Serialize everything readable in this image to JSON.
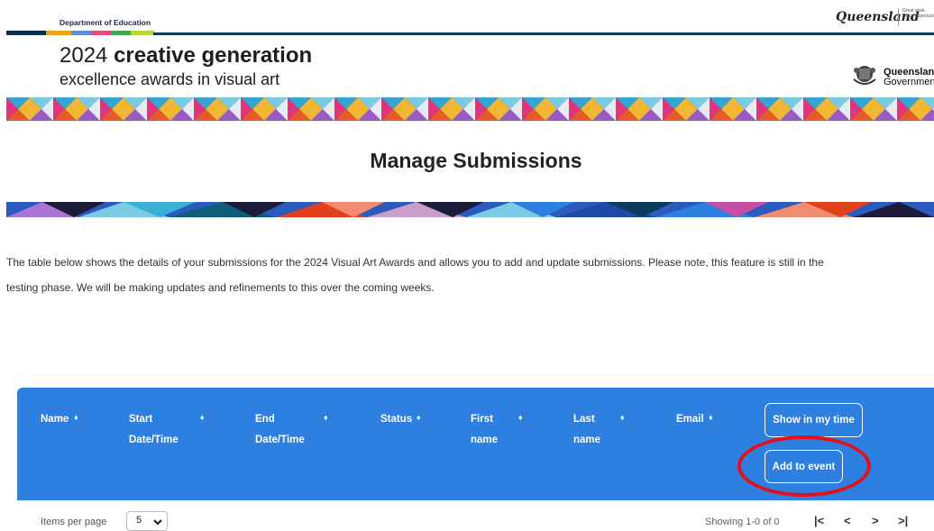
{
  "header": {
    "department": "Department of Education",
    "queensland_logo": "Queensland",
    "queensland_tagline": "Great state. Great opportunity.",
    "banner_title_year": "2024",
    "banner_title_bold": "creative generation",
    "banner_subtitle": "excellence awards in visual art",
    "gov_logo_line1": "Queensland",
    "gov_logo_line2": "Government"
  },
  "page": {
    "title": "Manage Submissions",
    "intro_line1": "The table below shows the details of your submissions for the 2024 Visual Art Awards and allows you to add and update submissions. Please note, this feature is still in the",
    "intro_line2": "testing phase. We will be making updates and refinements to this over the coming weeks."
  },
  "table": {
    "columns": {
      "name": "Name",
      "start_1": "Start",
      "start_2": "Date/Time",
      "end_1": "End",
      "end_2": "Date/Time",
      "status": "Status",
      "first_1": "First",
      "first_2": "name",
      "last_1": "Last",
      "last_2": "name",
      "email": "Email"
    },
    "sort_glyph": "♦",
    "show_in_my_time_label": "Show in my time",
    "add_to_event_label": "Add to event"
  },
  "pagination": {
    "items_per_page_label": "Items per page",
    "items_per_page_value": "5",
    "showing_text": "Showing 1-0 of 0",
    "first_glyph": "|<",
    "prev_glyph": "<",
    "next_glyph": ">",
    "last_glyph": ">|"
  },
  "colors": {
    "table_header": "#2d7fe0",
    "highlight_circle": "#e3101b",
    "header_rule": "#0d3b5c"
  },
  "icons": [
    "queensland-coat-of-arms-icon",
    "sort-icon",
    "chevron-down-icon",
    "first-page-icon",
    "prev-page-icon",
    "next-page-icon",
    "last-page-icon"
  ]
}
